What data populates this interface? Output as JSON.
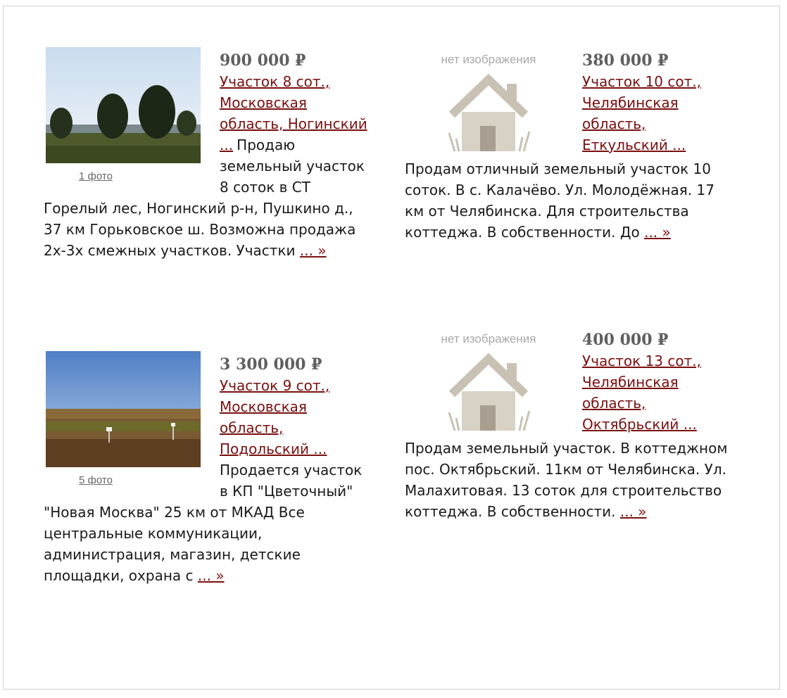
{
  "listings": [
    {
      "price": "900 000 ₽",
      "title": "Участок 8 сот., Московская область, Ногинский ...",
      "photo_caption": "1 фото",
      "description": "Продаю земельный участок 8 соток в СТ Горелый лес, Ногинский р-н, Пушкино д., 37 км Горьковское ш. Возможна продажа 2х-3х смежных участков. Участки",
      "more": "... »"
    },
    {
      "price": "380 000 ₽",
      "title": "Участок 10 сот., Челябинская область, Еткульский ...",
      "no_image_label": "нет изображения",
      "description": "Продам отличный земельный участок 10 соток. В с. Калачёво. Ул. Молодёжная. 17 км от Челябинска. Для строительства коттеджа. В собственности. До",
      "more": "... »"
    },
    {
      "price": "3 300 000 ₽",
      "title": "Участок 9 сот., Московская область, Подольский ...",
      "photo_caption": "5 фото",
      "description": "Продается участок в КП \"Цветочный\" \"Новая Москва\" 25 км от МКАД Все центральные коммуникации, администрация, магазин, детские площадки, охрана с",
      "more": "... »"
    },
    {
      "price": "400 000 ₽",
      "title": "Участок 13 сот., Челябинская область, Октябрьский ...",
      "no_image_label": "нет изображения",
      "description": "Продам земельный участок. В коттеджном пос. Октябрьский. 11км от Челябинска. Ул. Малахитовая. 13 соток для строительство коттеджа. В собственности.",
      "more": "... »"
    }
  ],
  "colors": {
    "link": "#7a1010",
    "price": "#5f5f5f",
    "placeholder": "#a9a9a9",
    "border": "#cfcfcf"
  }
}
